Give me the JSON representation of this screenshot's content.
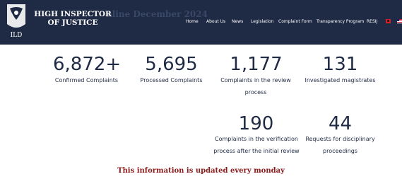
{
  "header": {
    "org_name": "HIGH INSPECTOR OF JUSTICE",
    "ghost_title": "nline December 2024",
    "logo_text": "ILD",
    "nav": [
      "Home",
      "About Us",
      "News",
      "Legislation",
      "Complaint Form",
      "Transparency Program",
      "RESIJ"
    ],
    "languages": [
      "albanian-flag-icon",
      "uk-flag-icon"
    ]
  },
  "stats": [
    {
      "value": "6,872+",
      "label": "Confirmed Complaints"
    },
    {
      "value": "5,695",
      "label": "Processed Complaints"
    },
    {
      "value": "1,177",
      "label": "Complaints in the review process"
    },
    {
      "value": "131",
      "label": "Investigated magistrates"
    },
    {
      "value": "190",
      "label": "Complaints in the verification process after the initial review"
    },
    {
      "value": "44",
      "label": "Requests for disciplinary proceedings"
    }
  ],
  "notice": "This information is updated every monday",
  "colors": {
    "navy": "#1f2a44",
    "notice_red": "#8b1a1a"
  }
}
